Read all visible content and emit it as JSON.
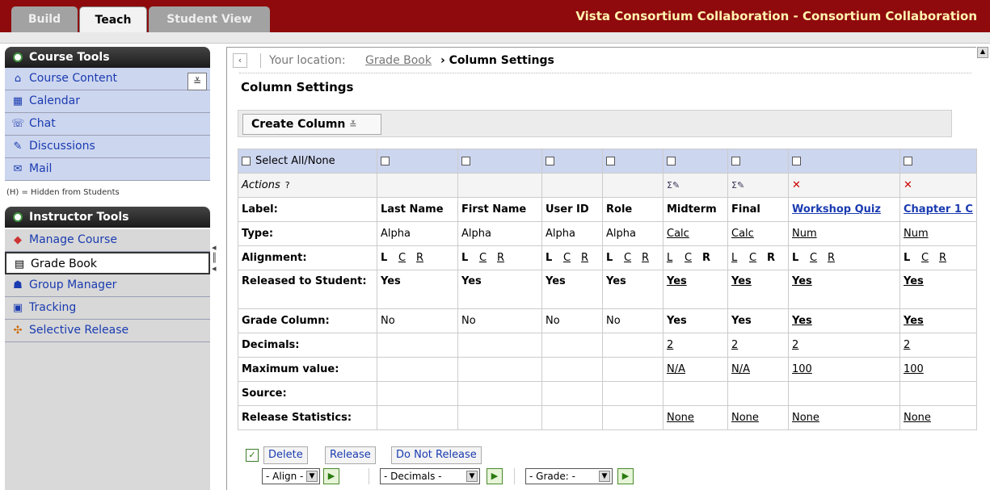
{
  "tabs": [
    "Build",
    "Teach",
    "Student View"
  ],
  "app_title": "Vista Consortium Collaboration - Consortium Collaboration",
  "course_tools": {
    "title": "Course Tools",
    "items": [
      "Course Content",
      "Calendar",
      "Chat",
      "Discussions",
      "Mail"
    ],
    "note": "(H) = Hidden from Students"
  },
  "instructor_tools": {
    "title": "Instructor Tools",
    "items": [
      "Manage Course",
      "Grade Book",
      "Group Manager",
      "Tracking",
      "Selective Release"
    ],
    "selected": "Grade Book"
  },
  "breadcrumb": {
    "label": "Your location:",
    "link": "Grade Book",
    "separator": "›",
    "current": "Column Settings"
  },
  "page_title": "Column Settings",
  "create_column": "Create Column",
  "grid": {
    "select_all": "Select All/None",
    "row_labels": [
      "Actions",
      "Label:",
      "Type:",
      "Alignment:",
      "Released to Student:",
      "Grade Column:",
      "Decimals:",
      "Maximum value:",
      "Source:",
      "Release Statistics:"
    ],
    "columns": [
      {
        "label": "Last Name",
        "type": "Alpha",
        "released": "Yes",
        "grade": "No",
        "decimals": "",
        "max": "",
        "stats": ""
      },
      {
        "label": "First Name",
        "type": "Alpha",
        "released": "Yes",
        "grade": "No",
        "decimals": "",
        "max": "",
        "stats": ""
      },
      {
        "label": "User ID",
        "type": "Alpha",
        "released": "Yes",
        "grade": "No",
        "decimals": "",
        "max": "",
        "stats": ""
      },
      {
        "label": "Role",
        "type": "Alpha",
        "released": "Yes",
        "grade": "No",
        "decimals": "",
        "max": "",
        "stats": ""
      },
      {
        "label": "Midterm",
        "type": "Calc",
        "released": "Yes",
        "grade": "Yes",
        "decimals": "2",
        "max": "N/A",
        "stats": "None"
      },
      {
        "label": "Final",
        "type": "Calc",
        "released": "Yes",
        "grade": "Yes",
        "decimals": "2",
        "max": "N/A",
        "stats": "None"
      },
      {
        "label": "Workshop Quiz",
        "type": "Num",
        "released": "Yes",
        "grade": "Yes",
        "decimals": "2",
        "max": "100",
        "stats": "None"
      },
      {
        "label": "Chapter 1 C",
        "type": "Num",
        "released": "Yes",
        "grade": "Yes",
        "decimals": "2",
        "max": "100",
        "stats": "None"
      }
    ],
    "align": [
      "L",
      "C",
      "R"
    ]
  },
  "actions": {
    "delete": "Delete",
    "release": "Release",
    "do_not_release": "Do Not Release",
    "align_select": "- Align -",
    "decimals_select": "- Decimals -",
    "grade_select": "- Grade: -"
  }
}
